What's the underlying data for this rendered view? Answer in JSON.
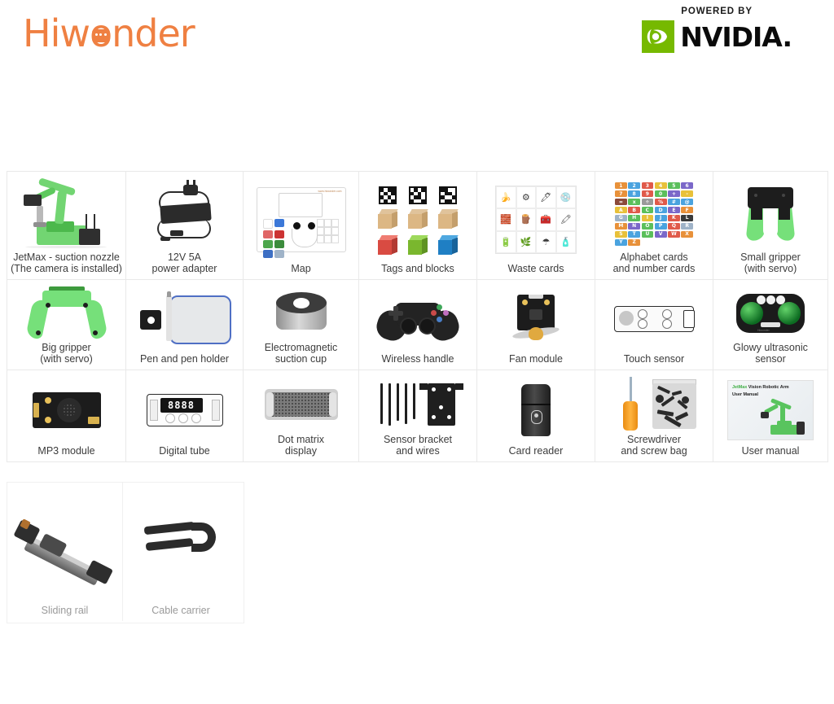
{
  "header": {
    "brand": "Hiwonder",
    "powered_by": "POWERED BY",
    "nvidia": "NVIDIA."
  },
  "manual_cover": {
    "brand": "JetMax",
    "title_rest": " Vision Robotic Arm",
    "subtitle": "User Manual"
  },
  "digital_tube_display": "8888",
  "items": [
    {
      "label": "JetMax - suction nozzle\n(The camera is installed)",
      "art": "robot-arm"
    },
    {
      "label": "12V 5A\npower adapter",
      "art": "power-adapter"
    },
    {
      "label": "Map",
      "art": "map-sheet"
    },
    {
      "label": "Tags and blocks",
      "art": "tags-blocks"
    },
    {
      "label": "Waste cards",
      "art": "waste-cards"
    },
    {
      "label": "Alphabet cards\nand number cards",
      "art": "alphabet-cards"
    },
    {
      "label": "Small gripper\n(with servo)",
      "art": "small-gripper"
    },
    {
      "label": "Big gripper\n(with servo)",
      "art": "big-gripper"
    },
    {
      "label": "Pen and pen holder",
      "art": "pen-holder"
    },
    {
      "label": "Electromagnetic\nsuction cup",
      "art": "electromagnet"
    },
    {
      "label": "Wireless handle",
      "art": "gamepad"
    },
    {
      "label": "Fan module",
      "art": "fan-module"
    },
    {
      "label": "Touch sensor",
      "art": "touch-sensor"
    },
    {
      "label": "Glowy ultrasonic\nsensor",
      "art": "ultrasonic-sensor"
    },
    {
      "label": "MP3 module",
      "art": "mp3-module"
    },
    {
      "label": "Digital tube",
      "art": "digital-tube"
    },
    {
      "label": "Dot matrix\ndisplay",
      "art": "dot-matrix"
    },
    {
      "label": "Sensor bracket\nand wires",
      "art": "sensor-bracket"
    },
    {
      "label": "Card reader",
      "art": "card-reader"
    },
    {
      "label": "Screwdriver\nand screw bag",
      "art": "screwdriver-bag"
    },
    {
      "label": "User manual",
      "art": "user-manual"
    }
  ],
  "extra_items": [
    {
      "label": "Sliding rail",
      "art": "sliding-rail"
    },
    {
      "label": "Cable carrier",
      "art": "cable-carrier"
    }
  ],
  "colors": {
    "brand_orange": "#ef8042",
    "nvidia_green": "#76b900",
    "robot_green": "#72d572",
    "label_text": "#3c3c3c",
    "muted_label_text": "#9a9a9a",
    "grid_line": "#e9e9e9"
  },
  "block_colors": [
    "#d94b42",
    "#7ab72e",
    "#1f7fc4"
  ],
  "map_palette": [
    "#ffffff",
    "#3c78d8",
    "#e06666",
    "#cc3333",
    "#4ca64c",
    "#3c8c3c",
    "#3d6fc4",
    "#9fb3c8"
  ],
  "alphabet_tiles": [
    {
      "t": "1",
      "c": "#e8913a"
    },
    {
      "t": "2",
      "c": "#4aa3df"
    },
    {
      "t": "3",
      "c": "#e05a4a"
    },
    {
      "t": "4",
      "c": "#e8c13a"
    },
    {
      "t": "5",
      "c": "#5bbf5b"
    },
    {
      "t": "6",
      "c": "#7b68c9"
    },
    {
      "t": "7",
      "c": "#e8913a"
    },
    {
      "t": "8",
      "c": "#4aa3df"
    },
    {
      "t": "9",
      "c": "#e05a4a"
    },
    {
      "t": "0",
      "c": "#5bbf5b"
    },
    {
      "t": "+",
      "c": "#7b68c9"
    },
    {
      "t": "-",
      "c": "#e8c13a"
    },
    {
      "t": "=",
      "c": "#8c4a3a"
    },
    {
      "t": "x",
      "c": "#5bbf5b"
    },
    {
      "t": "÷",
      "c": "#9a9a9a"
    },
    {
      "t": "%",
      "c": "#e05a4a"
    },
    {
      "t": "#",
      "c": "#4aa3df"
    },
    {
      "t": "@",
      "c": "#4aa3df"
    },
    {
      "t": "A",
      "c": "#e8c13a"
    },
    {
      "t": "B",
      "c": "#e05a4a"
    },
    {
      "t": "C",
      "c": "#5bbf5b"
    },
    {
      "t": "D",
      "c": "#4aa3df"
    },
    {
      "t": "E",
      "c": "#7b68c9"
    },
    {
      "t": "F",
      "c": "#e8913a"
    },
    {
      "t": "G",
      "c": "#9fb3c8"
    },
    {
      "t": "H",
      "c": "#5bbf5b"
    },
    {
      "t": "I",
      "c": "#e8c13a"
    },
    {
      "t": "J",
      "c": "#4aa3df"
    },
    {
      "t": "K",
      "c": "#e05a4a"
    },
    {
      "t": "L",
      "c": "#3a3a3a"
    },
    {
      "t": "M",
      "c": "#e8913a"
    },
    {
      "t": "N",
      "c": "#7b68c9"
    },
    {
      "t": "O",
      "c": "#5bbf5b"
    },
    {
      "t": "P",
      "c": "#4aa3df"
    },
    {
      "t": "Q",
      "c": "#e05a4a"
    },
    {
      "t": "R",
      "c": "#9fb3c8"
    },
    {
      "t": "S",
      "c": "#e8c13a"
    },
    {
      "t": "T",
      "c": "#4aa3df"
    },
    {
      "t": "U",
      "c": "#5bbf5b"
    },
    {
      "t": "V",
      "c": "#7b68c9"
    },
    {
      "t": "W",
      "c": "#e05a4a"
    },
    {
      "t": "X",
      "c": "#e8913a"
    },
    {
      "t": "Y",
      "c": "#4aa3df"
    },
    {
      "t": "Z",
      "c": "#e8913a"
    }
  ],
  "waste_card_icons": [
    "🍌",
    "⚙",
    "🖊",
    "💿",
    "🧱",
    "🪵",
    "🧰",
    "🖍",
    "🔋",
    "🌿",
    "☂",
    "🧴"
  ]
}
